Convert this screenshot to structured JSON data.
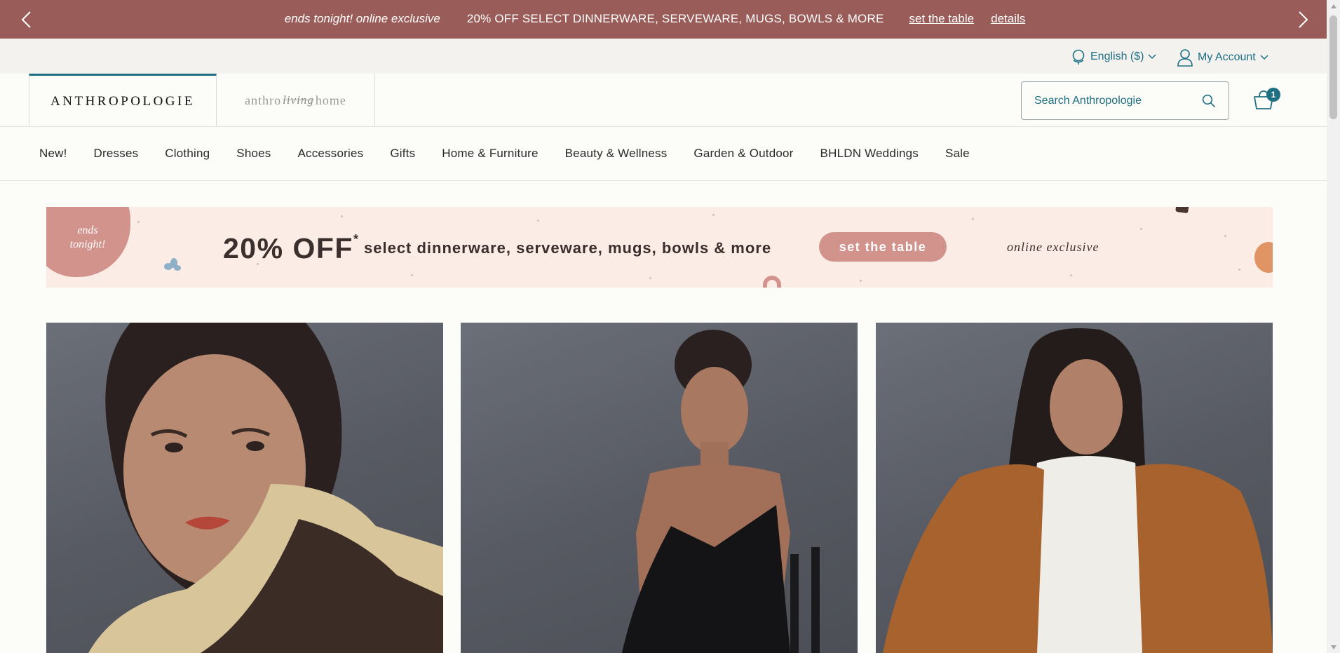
{
  "promo_bar": {
    "tonight": "ends tonight! online exclusive",
    "offer": "20% OFF SELECT DINNERWARE, SERVEWARE, MUGS, BOWLS & MORE",
    "link_table": "set the table",
    "link_details": "details"
  },
  "utility": {
    "language": "English ($)",
    "account": "My Account"
  },
  "brands": {
    "anthropologie": "ANTHROPOLOGIE",
    "home_prefix": "anthro",
    "home_living": "living",
    "home_suffix": "home"
  },
  "search": {
    "placeholder": "Search Anthropologie"
  },
  "cart": {
    "count": "1"
  },
  "nav": {
    "items": [
      "New!",
      "Dresses",
      "Clothing",
      "Shoes",
      "Accessories",
      "Gifts",
      "Home & Furniture",
      "Beauty & Wellness",
      "Garden & Outdoor",
      "BHLDN Weddings",
      "Sale"
    ]
  },
  "banner": {
    "ends_line1": "ends",
    "ends_line2": "tonight!",
    "big_off": "20% OFF",
    "asterisk": "*",
    "description": "select dinnerware, serveware, mugs, bowls & more",
    "cta": "set the table",
    "online": "online exclusive"
  },
  "colors": {
    "promo_bar": "#9a5c58",
    "accent_teal": "#1e6f83",
    "banner_bg": "#fcece6",
    "banner_pink": "#d3938d"
  },
  "icons": {
    "prev": "chevron-left-icon",
    "next": "chevron-right-icon",
    "globe": "globe-icon",
    "user": "user-icon",
    "search": "search-icon",
    "cart": "shopping-bag-icon"
  }
}
